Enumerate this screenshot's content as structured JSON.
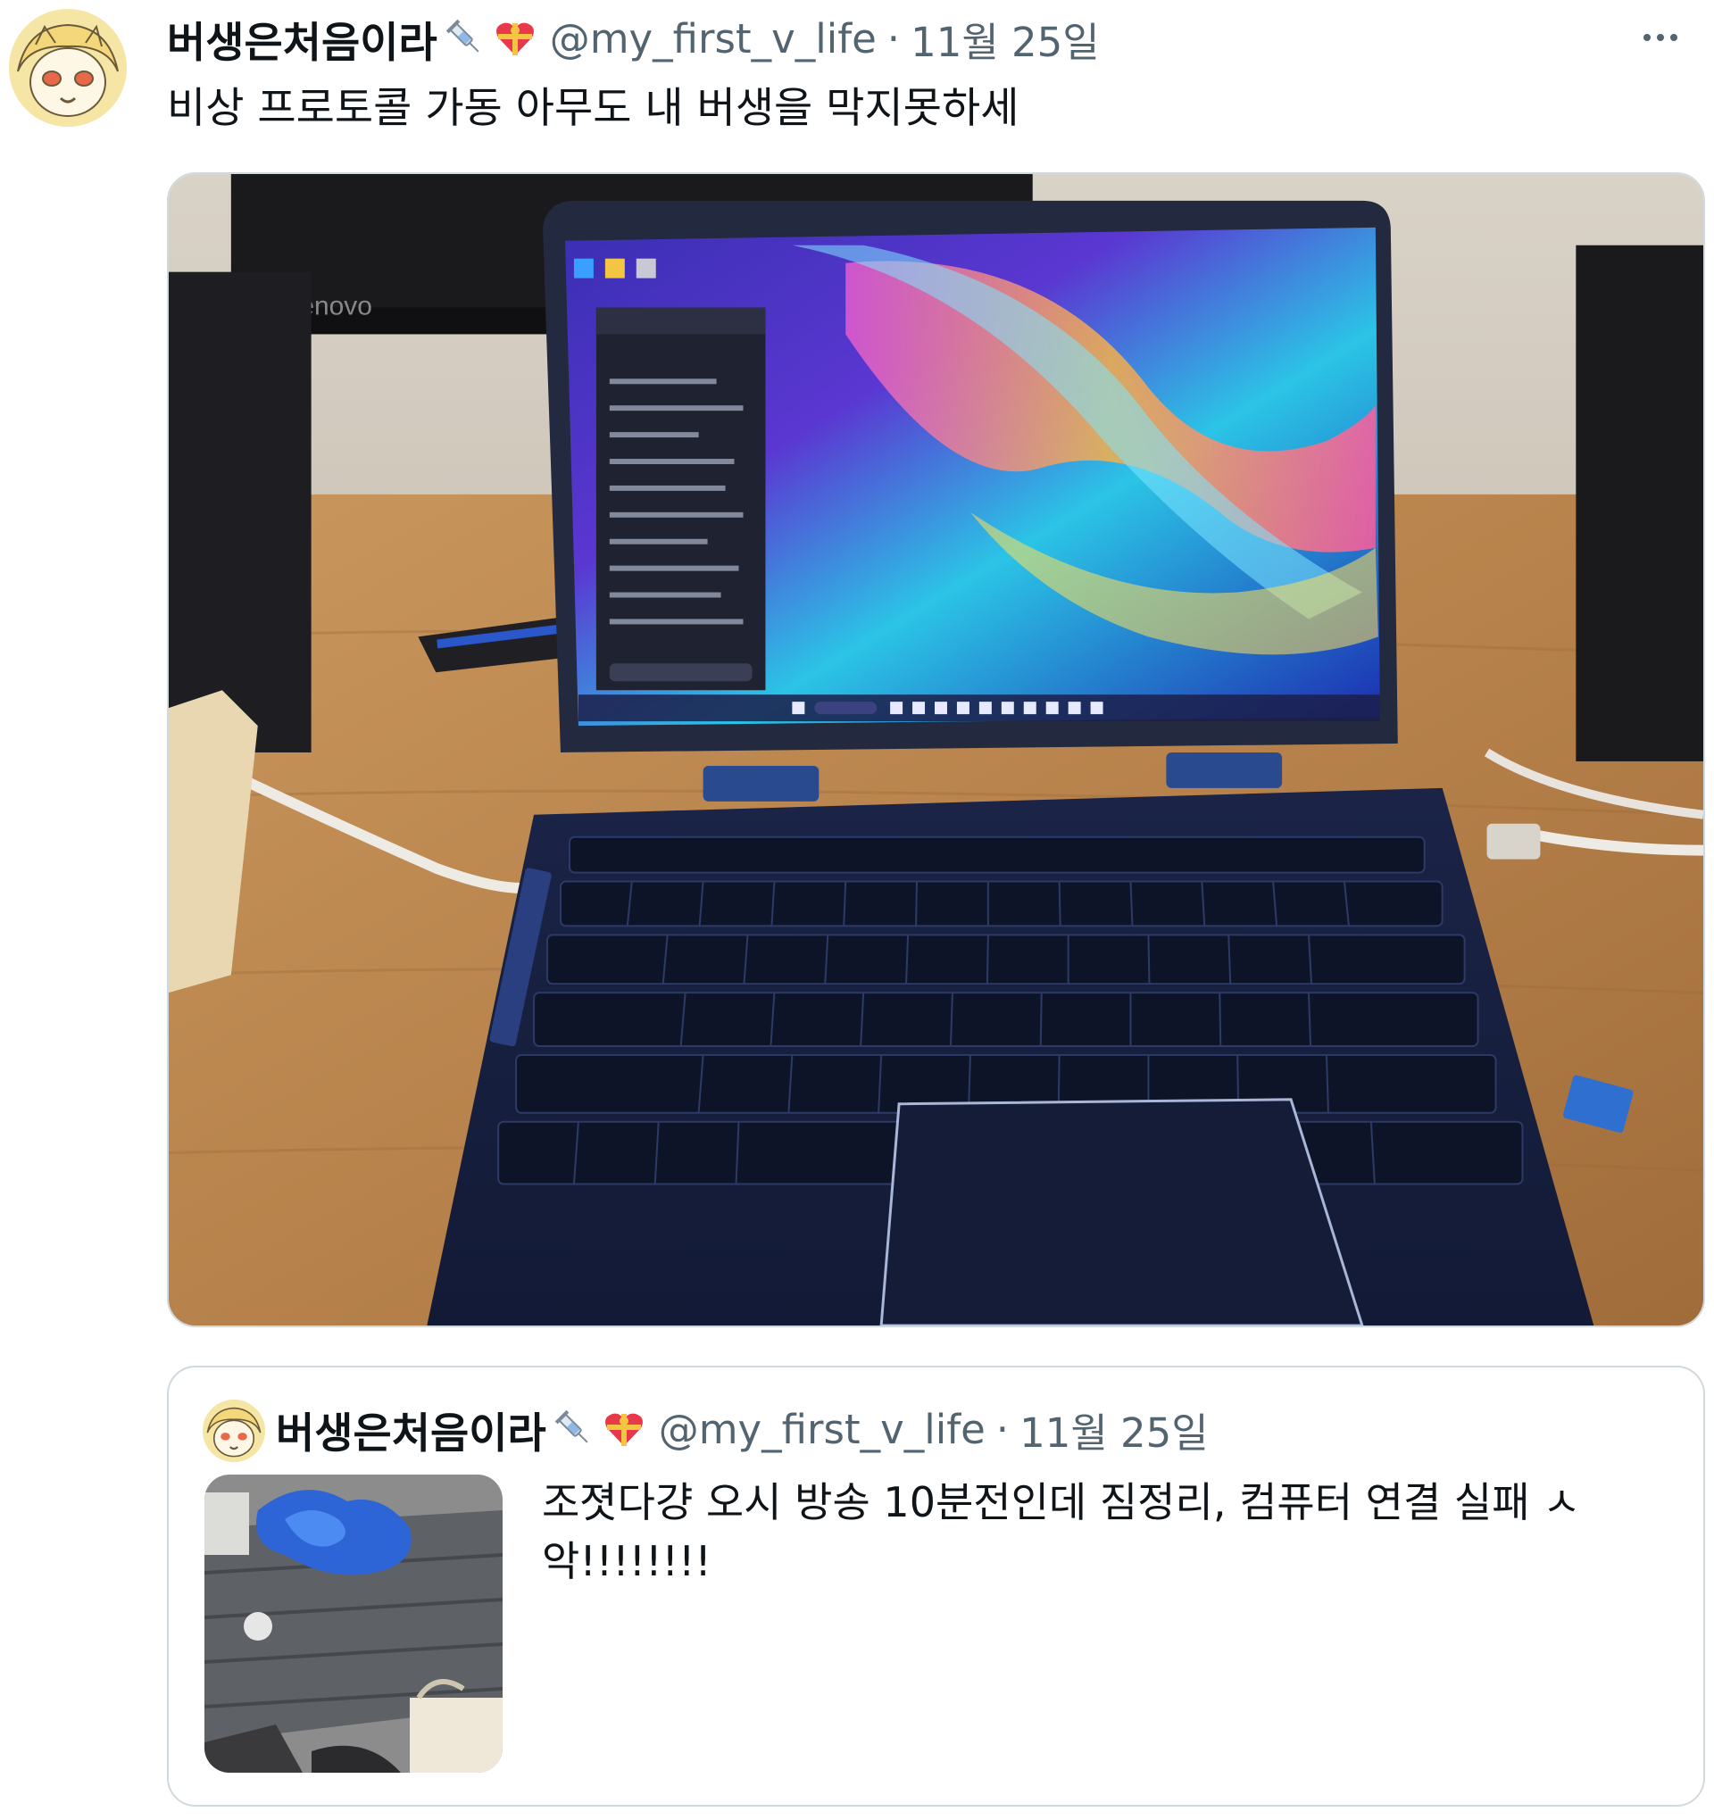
{
  "tweet": {
    "author": {
      "display_name": "버생은처음이라",
      "emoji_1": "syringe-emoji",
      "emoji_2": "heart-with-ribbon-emoji",
      "handle": "@my_first_v_life"
    },
    "separator": "·",
    "date": "11월 25일",
    "text": "비상 프로토콜 가동 아무도 내 버생을 막지못하세",
    "more_icon": "more-icon"
  },
  "media": {
    "description_icon": "photo-laptop",
    "monitor_brand": "Lenovo"
  },
  "quoted_tweet": {
    "author": {
      "display_name": "버생은처음이라",
      "emoji_1": "syringe-emoji",
      "emoji_2": "heart-with-ribbon-emoji",
      "handle": "@my_first_v_life"
    },
    "separator": "·",
    "date": "11월 25일",
    "text": "조졋다걍 오시 방송 10분전인데 짐정리, 컴퓨터 연결 실패 ㅅ악!!!!!!!!"
  },
  "colors": {
    "secondary_text": "#536471",
    "border": "#cfd9de"
  }
}
